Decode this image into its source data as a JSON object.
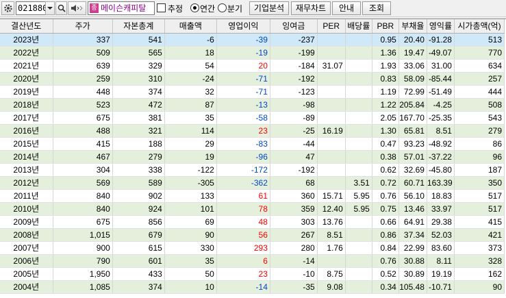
{
  "toolbar": {
    "stock_code": "021880",
    "stock_name_badge": "종",
    "stock_name": "메이슨캐피탈",
    "estimate_label": "추정",
    "annual_label": "연간",
    "quarter_label": "분기",
    "btn_company_analysis": "기업분석",
    "btn_financial_chart": "재무차트",
    "btn_guide": "안내",
    "btn_search": "조회"
  },
  "columns": [
    "결산년도",
    "주가",
    "자본총계",
    "매출액",
    "영업이익",
    "잉여금",
    "PER",
    "배당률",
    "PBR",
    "부채율",
    "영익률",
    "시가총액(억)"
  ],
  "rows": [
    {
      "year": "2023년",
      "price": "337",
      "equity": "541",
      "sales": "-6",
      "op": "-39",
      "op_sign": "neg",
      "surplus": "-237",
      "per": "",
      "div": "",
      "pbr": "0.95",
      "debt": "20.40",
      "opm": "-91.28",
      "cap": "513"
    },
    {
      "year": "2022년",
      "price": "509",
      "equity": "565",
      "sales": "18",
      "op": "-19",
      "op_sign": "neg",
      "surplus": "-199",
      "per": "",
      "div": "",
      "pbr": "1.36",
      "debt": "19.47",
      "opm": "-49.07",
      "cap": "770"
    },
    {
      "year": "2021년",
      "price": "639",
      "equity": "329",
      "sales": "54",
      "op": "20",
      "op_sign": "pos",
      "surplus": "-184",
      "per": "31.07",
      "div": "",
      "pbr": "1.93",
      "debt": "33.06",
      "opm": "31.00",
      "cap": "634"
    },
    {
      "year": "2020년",
      "price": "259",
      "equity": "310",
      "sales": "-24",
      "op": "-71",
      "op_sign": "neg",
      "surplus": "-192",
      "per": "",
      "div": "",
      "pbr": "0.83",
      "debt": "58.09",
      "opm": "-85.44",
      "cap": "257"
    },
    {
      "year": "2019년",
      "price": "448",
      "equity": "374",
      "sales": "32",
      "op": "-71",
      "op_sign": "neg",
      "surplus": "-123",
      "per": "",
      "div": "",
      "pbr": "1.19",
      "debt": "72.99",
      "opm": "-51.49",
      "cap": "444"
    },
    {
      "year": "2018년",
      "price": "523",
      "equity": "472",
      "sales": "87",
      "op": "-13",
      "op_sign": "neg",
      "surplus": "-98",
      "per": "",
      "div": "",
      "pbr": "1.22",
      "debt": "205.84",
      "opm": "-4.25",
      "cap": "508"
    },
    {
      "year": "2017년",
      "price": "675",
      "equity": "381",
      "sales": "35",
      "op": "-58",
      "op_sign": "neg",
      "surplus": "-89",
      "per": "",
      "div": "",
      "pbr": "2.05",
      "debt": "167.70",
      "opm": "-25.35",
      "cap": "543"
    },
    {
      "year": "2016년",
      "price": "488",
      "equity": "321",
      "sales": "114",
      "op": "23",
      "op_sign": "pos",
      "surplus": "-25",
      "per": "16.19",
      "div": "",
      "pbr": "1.30",
      "debt": "65.81",
      "opm": "8.51",
      "cap": "279"
    },
    {
      "year": "2015년",
      "price": "415",
      "equity": "188",
      "sales": "29",
      "op": "-83",
      "op_sign": "neg",
      "surplus": "-44",
      "per": "",
      "div": "",
      "pbr": "0.47",
      "debt": "93.23",
      "opm": "-48.92",
      "cap": "86"
    },
    {
      "year": "2014년",
      "price": "467",
      "equity": "279",
      "sales": "19",
      "op": "-96",
      "op_sign": "neg",
      "surplus": "47",
      "per": "",
      "div": "",
      "pbr": "0.38",
      "debt": "57.01",
      "opm": "-37.22",
      "cap": "96"
    },
    {
      "year": "2013년",
      "price": "304",
      "equity": "338",
      "sales": "-122",
      "op": "-172",
      "op_sign": "neg",
      "surplus": "-192",
      "per": "",
      "div": "",
      "pbr": "0.62",
      "debt": "32.69",
      "opm": "-45.80",
      "cap": "187"
    },
    {
      "year": "2012년",
      "price": "569",
      "equity": "589",
      "sales": "-305",
      "op": "-362",
      "op_sign": "neg",
      "surplus": "68",
      "per": "",
      "div": "3.51",
      "pbr": "0.72",
      "debt": "60.71",
      "opm": "163.39",
      "cap": "350"
    },
    {
      "year": "2011년",
      "price": "840",
      "equity": "902",
      "sales": "133",
      "op": "61",
      "op_sign": "pos",
      "surplus": "360",
      "per": "15.71",
      "div": "5.95",
      "pbr": "0.76",
      "debt": "56.10",
      "opm": "18.83",
      "cap": "517"
    },
    {
      "year": "2010년",
      "price": "840",
      "equity": "924",
      "sales": "101",
      "op": "78",
      "op_sign": "pos",
      "surplus": "359",
      "per": "12.40",
      "div": "5.95",
      "pbr": "0.75",
      "debt": "13.46",
      "opm": "33.97",
      "cap": "517"
    },
    {
      "year": "2009년",
      "price": "675",
      "equity": "856",
      "sales": "69",
      "op": "48",
      "op_sign": "pos",
      "surplus": "303",
      "per": "13.76",
      "div": "",
      "pbr": "0.66",
      "debt": "64.91",
      "opm": "29.38",
      "cap": "415"
    },
    {
      "year": "2008년",
      "price": "1,015",
      "equity": "679",
      "sales": "90",
      "op": "56",
      "op_sign": "pos",
      "surplus": "267",
      "per": "8.51",
      "div": "",
      "pbr": "0.86",
      "debt": "37.34",
      "opm": "52.03",
      "cap": "421"
    },
    {
      "year": "2007년",
      "price": "900",
      "equity": "615",
      "sales": "330",
      "op": "293",
      "op_sign": "pos",
      "surplus": "280",
      "per": "1.76",
      "div": "",
      "pbr": "0.84",
      "debt": "22.99",
      "opm": "83.60",
      "cap": "373"
    },
    {
      "year": "2006년",
      "price": "790",
      "equity": "601",
      "sales": "35",
      "op": "6",
      "op_sign": "pos",
      "surplus": "-14",
      "per": "",
      "div": "",
      "pbr": "0.76",
      "debt": "30.88",
      "opm": "8.11",
      "cap": "328"
    },
    {
      "year": "2005년",
      "price": "1,950",
      "equity": "433",
      "sales": "50",
      "op": "23",
      "op_sign": "pos",
      "surplus": "-10",
      "per": "8.75",
      "div": "",
      "pbr": "0.52",
      "debt": "30.89",
      "opm": "19.19",
      "cap": "162"
    },
    {
      "year": "2004년",
      "price": "1,085",
      "equity": "374",
      "sales": "10",
      "op": "-14",
      "op_sign": "neg",
      "surplus": "-35",
      "per": "9.08",
      "div": "",
      "pbr": "0.34",
      "debt": "105.48",
      "opm": "-10.71",
      "cap": "90"
    }
  ],
  "colors": {
    "positive": "#ff0000",
    "negative": "#0046c8",
    "selected_row": "#cfe9f9",
    "alt_row": "#e4f0dc"
  }
}
